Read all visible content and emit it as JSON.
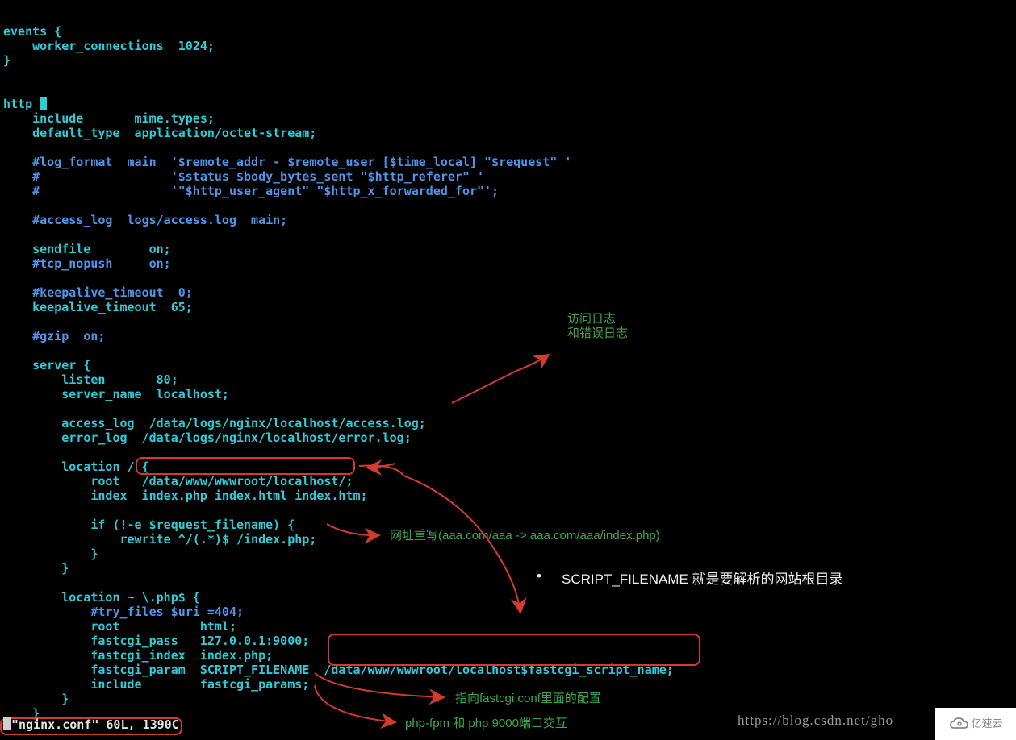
{
  "code": {
    "l01": "events {",
    "l02": "    worker_connections  1024;",
    "l03": "}",
    "l04": "",
    "l05": "",
    "l06_a": "http ",
    "l06_b": "",
    "l07": "    include       mime.types;",
    "l08": "    default_type  application/octet-stream;",
    "l09": "",
    "l10": "    #log_format  main  '$remote_addr - $remote_user [$time_local] \"$request\" '",
    "l11": "    #                  '$status $body_bytes_sent \"$http_referer\" '",
    "l12": "    #                  '\"$http_user_agent\" \"$http_x_forwarded_for\"';",
    "l13": "",
    "l14": "    #access_log  logs/access.log  main;",
    "l15": "",
    "l16": "    sendfile        on;",
    "l17": "    #tcp_nopush     on;",
    "l18": "",
    "l19": "    #keepalive_timeout  0;",
    "l20": "    keepalive_timeout  65;",
    "l21": "",
    "l22": "    #gzip  on;",
    "l23": "",
    "l24": "    server {",
    "l25": "        listen       80;",
    "l26": "        server_name  localhost;",
    "l27": "",
    "l28": "        access_log  /data/logs/nginx/localhost/access.log;",
    "l29": "        error_log  /data/logs/nginx/localhost/error.log;",
    "l30": "",
    "l31": "        location / {",
    "l32": "            root   /data/www/wwwroot/localhost/;",
    "l33": "            index  index.php index.html index.htm;",
    "l34": "",
    "l35": "            if (!-e $request_filename) {",
    "l36": "                rewrite ^/(.*)$ /index.php;",
    "l37": "            }",
    "l38": "        }",
    "l39": "",
    "l40": "        location ~ \\.php$ {",
    "l41": "            #try_files $uri =404;",
    "l42": "            root           html;",
    "l43": "            fastcgi_pass   127.0.0.1:9000;",
    "l44": "            fastcgi_index  index.php;",
    "l45a": "            fastcgi_param  SCRIPT_FILENAME",
    "l45b": "  /data/www/wwwroot/localhost$fastcgi_script_name;",
    "l46": "            include        fastcgi_params;",
    "l47": "        }",
    "l48": "    }"
  },
  "status": "\"nginx.conf\" 60L, 1390C",
  "annotations": {
    "access_log_1": "访问日志",
    "access_log_2": "和错误日志",
    "rewrite": "网址重写(aaa.com/aaa -> aaa.com/aaa/index.php)",
    "script_filename": "SCRIPT_FILENAME 就是要解析的网站根目录",
    "fastcgi_conf": "指向fastcgi.conf里面的配置",
    "phpfpm": "php-fpm 和 php 9000端口交互"
  },
  "url": "https://blog.csdn.net/gho",
  "watermark": "亿速云"
}
